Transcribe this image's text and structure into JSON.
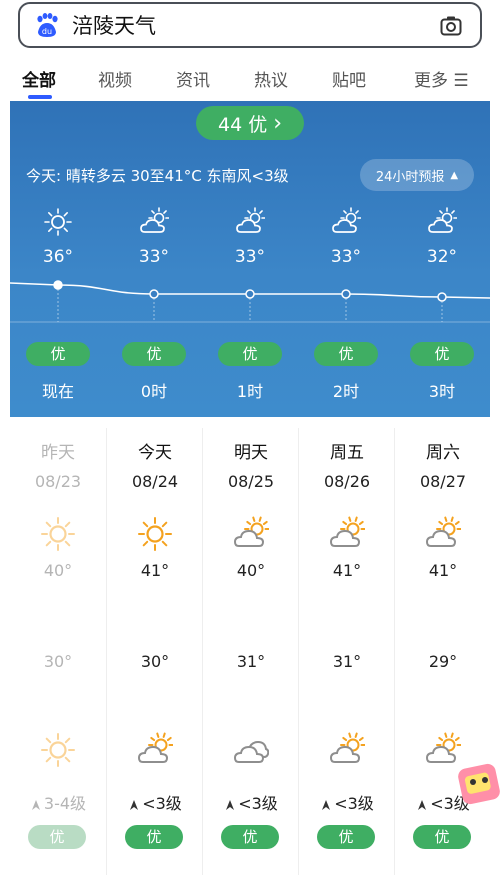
{
  "search": {
    "query": "涪陵天气"
  },
  "tabs": [
    {
      "label": "全部"
    },
    {
      "label": "视频"
    },
    {
      "label": "资讯"
    },
    {
      "label": "热议"
    },
    {
      "label": "贴吧"
    },
    {
      "label": "更多 ☰"
    }
  ],
  "aqi_pill": {
    "label": "44 优",
    "arrow": "›"
  },
  "today_summary": "今天:  晴转多云   30至41°C   东南风<3级",
  "forecast_button": {
    "label": "24小时预报",
    "caret": "▲"
  },
  "hourly": [
    {
      "icon": "sun-icon",
      "temp": "36°",
      "aqi": "优",
      "label": "现在",
      "temp_value": 36
    },
    {
      "icon": "partly-cloudy-icon",
      "temp": "33°",
      "aqi": "优",
      "label": "0时",
      "temp_value": 33
    },
    {
      "icon": "partly-cloudy-icon",
      "temp": "33°",
      "aqi": "优",
      "label": "1时",
      "temp_value": 33
    },
    {
      "icon": "partly-cloudy-icon",
      "temp": "33°",
      "aqi": "优",
      "label": "2时",
      "temp_value": 33
    },
    {
      "icon": "partly-cloudy-icon",
      "temp": "32°",
      "aqi": "优",
      "label": "3时",
      "temp_value": 32
    }
  ],
  "daily": [
    {
      "name": "昨天",
      "date": "08/23",
      "day_icon": "sun-icon",
      "high": "40°",
      "low": "30°",
      "night_icon": "sun-icon",
      "wind": "3-4级",
      "wind_icon": "wind-arrow-icon",
      "aqi": "优",
      "past": true,
      "high_value": 40,
      "low_value": 30
    },
    {
      "name": "今天",
      "date": "08/24",
      "day_icon": "sun-icon",
      "high": "41°",
      "low": "30°",
      "night_icon": "partly-cloudy-icon",
      "wind": "<3级",
      "wind_icon": "wind-arrow-icon",
      "aqi": "优",
      "past": false,
      "high_value": 41,
      "low_value": 30
    },
    {
      "name": "明天",
      "date": "08/25",
      "day_icon": "partly-cloudy-icon",
      "high": "40°",
      "low": "31°",
      "night_icon": "cloudy-icon",
      "wind": "<3级",
      "wind_icon": "wind-arrow-icon",
      "aqi": "优",
      "past": false,
      "high_value": 40,
      "low_value": 31
    },
    {
      "name": "周五",
      "date": "08/26",
      "day_icon": "partly-cloudy-icon",
      "high": "41°",
      "low": "31°",
      "night_icon": "partly-cloudy-icon",
      "wind": "<3级",
      "wind_icon": "wind-arrow-icon",
      "aqi": "优",
      "past": false,
      "high_value": 41,
      "low_value": 31
    },
    {
      "name": "周六",
      "date": "08/27",
      "day_icon": "partly-cloudy-icon",
      "high": "41°",
      "low": "29°",
      "night_icon": "partly-cloudy-icon",
      "wind": "<3级",
      "wind_icon": "wind-arrow-icon",
      "aqi": "优",
      "past": false,
      "high_value": 41,
      "low_value": 29
    }
  ],
  "colors": {
    "accent": "#2e5bff",
    "panel": "#3579bd",
    "aqi_good": "#3fae63",
    "sun": "#f4a21f"
  }
}
